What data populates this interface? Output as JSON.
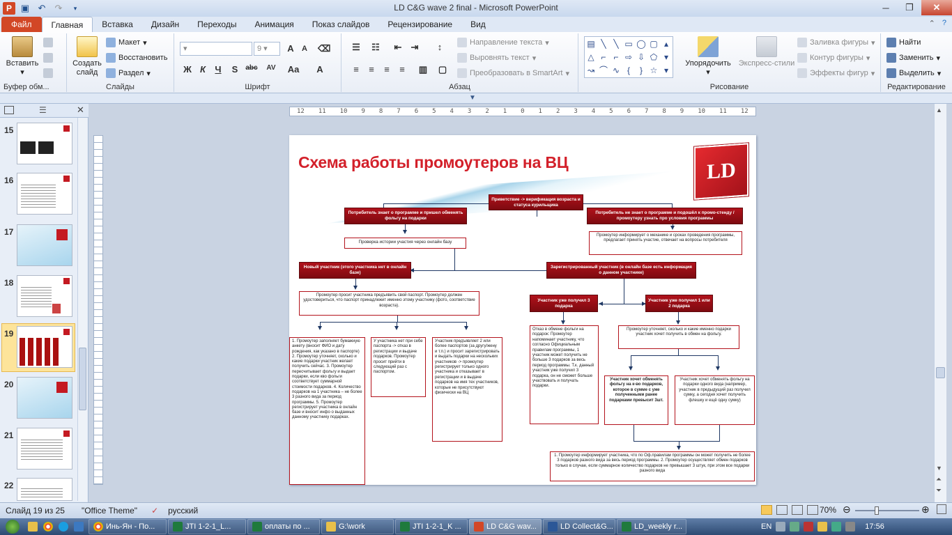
{
  "window": {
    "title": "LD C&G wave 2 final  -  Microsoft PowerPoint"
  },
  "tabs": [
    {
      "label": "Файл"
    },
    {
      "label": "Главная"
    },
    {
      "label": "Вставка"
    },
    {
      "label": "Дизайн"
    },
    {
      "label": "Переходы"
    },
    {
      "label": "Анимация"
    },
    {
      "label": "Показ слайдов"
    },
    {
      "label": "Рецензирование"
    },
    {
      "label": "Вид"
    }
  ],
  "ribbon": {
    "clipboard": {
      "label": "Буфер обм...",
      "paste": "Вставить"
    },
    "slides": {
      "label": "Слайды",
      "new_slide": "Создать слайд",
      "layout": "Макет",
      "reset": "Восстановить",
      "section": "Раздел"
    },
    "font": {
      "label": "Шрифт",
      "size": "9"
    },
    "paragraph": {
      "label": "Абзац",
      "text_direction": "Направление текста",
      "align_text": "Выровнять текст",
      "convert_smartart": "Преобразовать в SmartArt"
    },
    "drawing": {
      "label": "Рисование",
      "arrange": "Упорядочить",
      "quick_styles": "Экспресс-стили",
      "fill": "Заливка фигуры",
      "outline": "Контур фигуры",
      "effects": "Эффекты фигур"
    },
    "editing": {
      "label": "Редактирование",
      "find": "Найти",
      "replace": "Заменить",
      "select": "Выделить"
    }
  },
  "thumbnails": [
    {
      "num": "15"
    },
    {
      "num": "16"
    },
    {
      "num": "17"
    },
    {
      "num": "18"
    },
    {
      "num": "19"
    },
    {
      "num": "20"
    },
    {
      "num": "21"
    },
    {
      "num": "22"
    }
  ],
  "ruler": {
    "h": [
      "12",
      "11",
      "10",
      "9",
      "8",
      "7",
      "6",
      "5",
      "4",
      "3",
      "2",
      "1",
      "0",
      "1",
      "2",
      "3",
      "4",
      "5",
      "6",
      "7",
      "8",
      "9",
      "10",
      "11",
      "12"
    ]
  },
  "slide": {
    "title": "Схема работы промоутеров на ВЦ",
    "logo": "LD",
    "b_greet": "Приветствие   -> верификация возраста  и статуса курильщика",
    "b_knows": "Потребитель  знает о программе и пришел обменять  фольгу  на подарки",
    "b_notknows": "Потребитель   не знает о программе и подошёл  к промо-стенду  / промоутеру  узнать  про условия  программы",
    "w_history": "Проверка  истории участия через онлайн базу",
    "w_inform": "Промоутер  информирует о механике и сроках проведения программы, предлагает  принять  участие, отвечает  на вопросы потребителя",
    "b_new": "Новый участник  (этого участника  нет в онлайн  базе)",
    "b_registered": "Зарегистрированный  участник  (в онлайн  базе есть информация  о данном  участнике)",
    "w_passport": "Промоутер  просит участника предъявить  свой паспорт. Промоутер должен удостовериться, что паспорт принадлежит именно этому участнику (фото,  соответствие возраста).",
    "b_got3": "Участник  уже получил 3 подарка",
    "b_got12": "Участник  уже получил 1 или  2 подарка",
    "w_fill": "1. Промоутер  заполняет бумажную анкету (вносит ФИО и дату  рождения, как указано в паспорте) 2. Промоутер  уточняет, сколько и какие подарки участник желает  получить  сейчас. 3. Промоутер пересчитывает фольгу и выдает подарки, если кво фольги соответствует суммарной  стоимости подарков. 4. Количество подарков на 1 участника – не более 3 разного вида за период программы. 5. Промоутер регистрирует участника в онлайн базе и вносит инфо о выданных данному участнику подарках.",
    "w_nopass": "У участника  нет при  себе паспорта  -> отказ в регистрации  и выдаче подарков. Промоутер  просит прийти в следующий раз с паспортом.",
    "w_2pass": "Участник  предъявляет 2 или  более  паспортов (за другу/жену и т.п.) и просит зарегистрировать  и выдать подарки  на нескольких участников  -> промоутер регистрирует только одного участника и отказывает  в регистрации и в выдаче подарков на имя тех участников, которые  не присутствуют физически на ВЦ",
    "w_refuse": "Отказ  в обмене фольги  на подарок: Промоутер  напоминает участнику, что согласно Официальным правилам программы, 1 участник может получить не больше 3 подарков за весь период программы. Т.к. данный участник уже получил 3 подарка, он не сможет больше участвовать и получать подарки.",
    "w_clarify": "Промоутер уточняет, сколько и какие именно подарки участник хочет получить в обмен на фольгу.",
    "w_wantkol": "Участник  хочет обменять  фольгу  на к-во подарков, которое  в сумме с уже полученными ранее  подарками превысит  3шт.",
    "w_wantone": "Участник  хочет обменять фольгу на подарки одного вида (например, участник в предыдущий  раз получил сумку, а сегодня хочет получить флешку и ещё одну сумку)",
    "w_bottom": "1. Промоутер  информирует участника, что по Оф.правилам  программы он может получить не более 3 подарков  разного вида за весь период программы. 2. Промоутер  осуществляет обмен подарков только  в случае, если суммарное количество подарков  не превышает 3 штук, при этом все подарки разного вида"
  },
  "status": {
    "slide": "Слайд 19 из 25",
    "theme": "\"Office Theme\"",
    "lang": "русский",
    "zoom": "70%"
  },
  "taskbar": [
    {
      "label": "Инь-Ян - По..."
    },
    {
      "label": "JTI 1-2-1_L..."
    },
    {
      "label": "оплаты по ..."
    },
    {
      "label": "G:\\work"
    },
    {
      "label": "JTI 1-2-1_K ..."
    },
    {
      "label": "LD C&G wav..."
    },
    {
      "label": "LD Collect&G..."
    },
    {
      "label": "LD_weekly r..."
    }
  ],
  "tray": {
    "lang": "EN",
    "time": "17:56"
  },
  "colors": {
    "accent": "#d24726",
    "slide_red": "#b0121b",
    "arrow": "#1f3864"
  }
}
